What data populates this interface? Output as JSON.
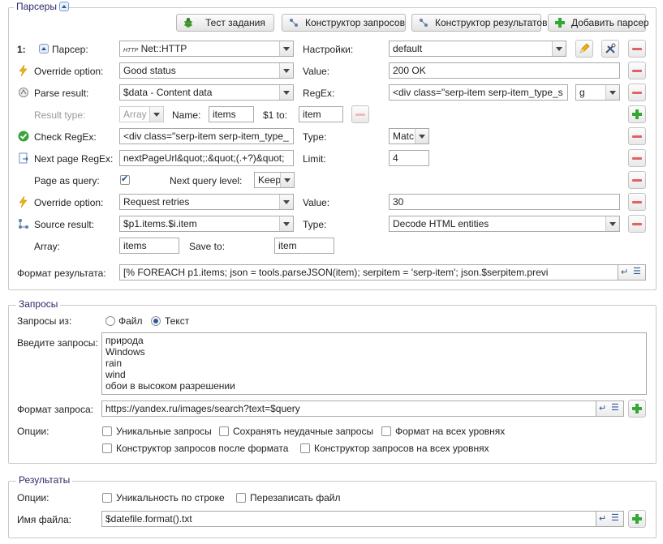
{
  "parsers": {
    "legend": "Парсеры",
    "buttons": {
      "test": "Тест задания",
      "query_builder": "Конструктор запросов",
      "result_builder": "Конструктор результатов",
      "add_parser": "Добавить парсер"
    },
    "index": "1:",
    "parser_label": "Парсер:",
    "parser_value": "Net::HTTP",
    "settings_label": "Настройки:",
    "settings_value": "default",
    "override1_label": "Override option:",
    "override1_value": "Good status",
    "value_label": "Value:",
    "override1_val": "200 OK",
    "parse_result_label": "Parse result:",
    "parse_result_value": "$data - Content data",
    "regex_label": "RegEx:",
    "regex_value": "<div class=\"serp-item serp-item_type_s",
    "regex_flag": "g",
    "result_type_label": "Result type:",
    "result_type_value": "Array",
    "name_label": "Name:",
    "name_value": "items",
    "one_to_label": "$1 to:",
    "one_to_value": "item",
    "check_regex_label": "Check RegEx:",
    "check_regex_value": "<div class=\"serp-item serp-item_type_",
    "type_label": "Type:",
    "check_type_value": "Matc",
    "next_page_label": "Next page RegEx:",
    "next_page_value": "nextPageUrl&quot;:&quot;(.+?)&quot;",
    "limit_label": "Limit:",
    "limit_value": "4",
    "page_as_query_label": "Page as query:",
    "next_query_level_label": "Next query level:",
    "next_query_level_value": "Keep",
    "override2_label": "Override option:",
    "override2_value": "Request retries",
    "override2_val": "30",
    "source_result_label": "Source result:",
    "source_result_value": "$p1.items.$i.item",
    "source_type_value": "Decode HTML entities",
    "array_label": "Array:",
    "array_value": "items",
    "save_to_label": "Save to:",
    "save_to_value": "item",
    "format_label": "Формат результата:",
    "format_value": "[% FOREACH p1.items;        json = tools.parseJSON(item);        serpitem = 'serp-item';        json.$serpitem.previ"
  },
  "queries": {
    "legend": "Запросы",
    "from_label": "Запросы из:",
    "from_file": "Файл",
    "from_text": "Текст",
    "enter_label": "Введите запросы:",
    "lines": [
      "природа",
      "Windows",
      "rain",
      "wind",
      "обои в высоком разрешении"
    ],
    "format_label": "Формат запроса:",
    "format_value": "https://yandex.ru/images/search?text=$query",
    "options_label": "Опции:",
    "opt_unique": "Уникальные запросы",
    "opt_save_failed": "Сохранять неудачные запросы",
    "opt_format_all": "Формат на всех уровнях",
    "opt_builder_after": "Конструктор запросов после формата",
    "opt_builder_all": "Конструктор запросов на всех уровнях"
  },
  "results": {
    "legend": "Результаты",
    "options_label": "Опции:",
    "opt_unique_line": "Уникальность по строке",
    "opt_overwrite": "Перезаписать файл",
    "filename_label": "Имя файла:",
    "filename_value": "$datefile.format().txt"
  }
}
